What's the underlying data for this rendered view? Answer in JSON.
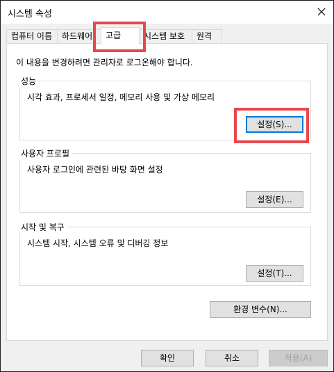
{
  "window": {
    "title": "시스템 속성",
    "close_icon": "close-icon"
  },
  "tabs": [
    {
      "label": "컴퓨터 이름"
    },
    {
      "label": "하드웨어"
    },
    {
      "label": "고급",
      "active": true
    },
    {
      "label": "시스템 보호"
    },
    {
      "label": "원격"
    }
  ],
  "notice": "이 내용을 변경하려면 관리자로 로그온해야 합니다.",
  "performance": {
    "title": "성능",
    "description": "시각 효과, 프로세서 일정, 메모리 사용 및 가상 메모리",
    "button": "설정(S)..."
  },
  "profiles": {
    "title": "사용자 프로필",
    "description": "사용자 로그인에 관련된 바탕 화면 설정",
    "button": "설정(E)..."
  },
  "startup": {
    "title": "시작 및 복구",
    "description": "시스템 시작, 시스템 오류 및 디버깅 정보",
    "button": "설정(T)..."
  },
  "env_button": "환경 변수(N)...",
  "footer": {
    "ok": "확인",
    "cancel": "취소",
    "apply": "적용(A)"
  },
  "colors": {
    "highlight": "#e8474d",
    "focus": "#0078d7"
  }
}
